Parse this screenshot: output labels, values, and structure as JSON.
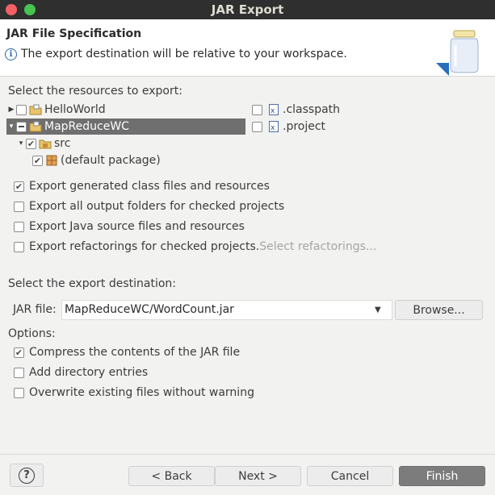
{
  "window": {
    "title": "JAR Export"
  },
  "header": {
    "title": "JAR File Specification",
    "message": "The export destination will be relative to your workspace."
  },
  "resources": {
    "label": "Select the resources to export:",
    "tree": [
      {
        "label": "HelloWorld",
        "state": "unchecked",
        "expanded": false,
        "icon": "project-icon"
      },
      {
        "label": "MapReduceWC",
        "state": "partial",
        "expanded": true,
        "selected": true,
        "icon": "project-icon"
      },
      {
        "label": "src",
        "state": "checked",
        "expanded": true,
        "icon": "source-folder-icon"
      },
      {
        "label": "(default package)",
        "state": "checked",
        "icon": "package-icon"
      }
    ],
    "files": [
      {
        "label": ".classpath",
        "state": "unchecked",
        "icon": "xml-file-icon"
      },
      {
        "label": ".project",
        "state": "unchecked",
        "icon": "xml-file-icon"
      }
    ]
  },
  "export_options": [
    {
      "label": "Export generated class files and resources",
      "checked": true
    },
    {
      "label": "Export all output folders for checked projects",
      "checked": false
    },
    {
      "label": "Export Java source files and resources",
      "checked": false
    },
    {
      "label": "Export refactorings for checked projects.",
      "checked": false
    }
  ],
  "select_refactorings": "Select refactorings...",
  "destination": {
    "label": "Select the export destination:",
    "jar_label": "JAR file:",
    "jar_value": "MapReduceWC/WordCount.jar",
    "browse": "Browse..."
  },
  "options": {
    "label": "Options:",
    "items": [
      {
        "label": "Compress the contents of the JAR file",
        "checked": true
      },
      {
        "label": "Add directory entries",
        "checked": false
      },
      {
        "label": "Overwrite existing files without warning",
        "checked": false
      }
    ]
  },
  "buttons": {
    "help": "?",
    "back": "< Back",
    "next": "Next >",
    "cancel": "Cancel",
    "finish": "Finish"
  },
  "colors": {
    "accent": "#7c7c7c",
    "titlebar": "#2f2f2f",
    "close": "#f46067",
    "maximize": "#45c44f"
  }
}
